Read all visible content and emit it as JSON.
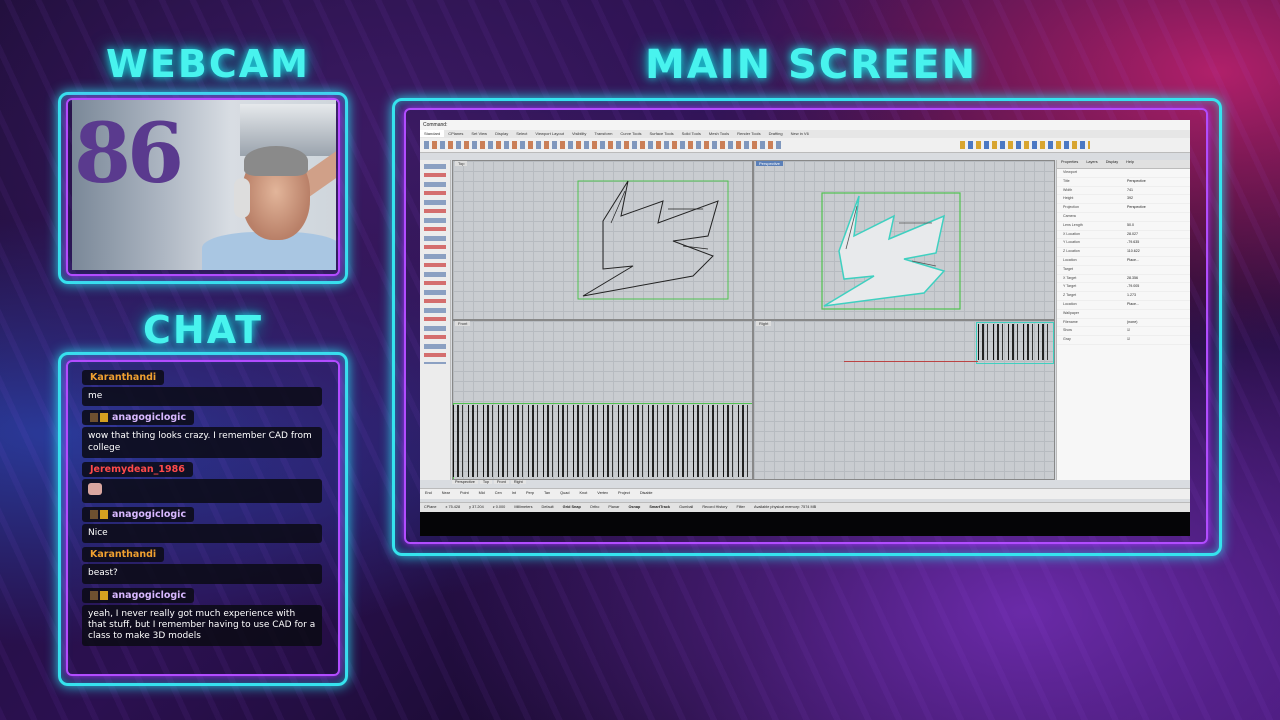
{
  "headings": {
    "webcam": "WEBCAM",
    "main_screen": "MAIN SCREEN",
    "chat": "CHAT"
  },
  "colors": {
    "heading": "#48f3ee",
    "frame": "#35e4ee",
    "frame_accent": "#b24cff"
  },
  "webcam": {
    "overlay_number": "86"
  },
  "chat": {
    "messages": [
      {
        "user": "Karanthandi",
        "color": "#f0a030",
        "text": "me",
        "badges": false
      },
      {
        "user": "anagogiclogic",
        "color": "#d8b8ff",
        "text": "wow that thing looks crazy. I remember CAD from college",
        "badges": true
      },
      {
        "user": "Jeremydean_1986",
        "color": "#ff4a4a",
        "text": "",
        "emote": "emote-icon",
        "badges": false
      },
      {
        "user": "anagogiclogic",
        "color": "#d8b8ff",
        "text": "Nice",
        "badges": true
      },
      {
        "user": "Karanthandi",
        "color": "#f0a030",
        "text": "beast?",
        "badges": false
      },
      {
        "user": "anagogiclogic",
        "color": "#d8b8ff",
        "text": "yeah, I never really got much experience with that stuff, but I remember having to use CAD for a class to make 3D models",
        "badges": true
      }
    ]
  },
  "app": {
    "command_prompt": "Command:",
    "tabs": [
      "Standard",
      "CPlanes",
      "Set View",
      "Display",
      "Select",
      "Viewport Layout",
      "Visibility",
      "Transform",
      "Curve Tools",
      "Surface Tools",
      "Solid Tools",
      "Mesh Tools",
      "Render Tools",
      "Drafting",
      "New in V6"
    ],
    "viewports": {
      "top": "Top",
      "perspective": "Perspective",
      "front": "Front",
      "right": "Right"
    },
    "view_tabs": [
      "Perspective",
      "Top",
      "Front",
      "Right"
    ],
    "properties": {
      "tabs": [
        "Properties",
        "Layers",
        "Display",
        "Help"
      ],
      "rows": [
        {
          "k": "Viewport",
          "v": ""
        },
        {
          "k": "Title",
          "v": "Perspective"
        },
        {
          "k": "Width",
          "v": "741"
        },
        {
          "k": "Height",
          "v": "392"
        },
        {
          "k": "Projection",
          "v": "Perspective"
        },
        {
          "k": "Camera",
          "v": ""
        },
        {
          "k": "Lens Length",
          "v": "50.0"
        },
        {
          "k": "X Location",
          "v": "28.027"
        },
        {
          "k": "Y Location",
          "v": "-79.635"
        },
        {
          "k": "Z Location",
          "v": "110.622"
        },
        {
          "k": "Location",
          "v": "Place..."
        },
        {
          "k": "Target",
          "v": ""
        },
        {
          "k": "X Target",
          "v": "28.356"
        },
        {
          "k": "Y Target",
          "v": "-79.005"
        },
        {
          "k": "Z Target",
          "v": "1.273"
        },
        {
          "k": "Location",
          "v": "Place..."
        },
        {
          "k": "Wallpaper",
          "v": ""
        },
        {
          "k": "Filename",
          "v": "(none)"
        },
        {
          "k": "Show",
          "v": "☑"
        },
        {
          "k": "Gray",
          "v": "☑"
        }
      ]
    },
    "osnap": [
      "End",
      "Near",
      "Point",
      "Mid",
      "Cen",
      "Int",
      "Perp",
      "Tan",
      "Quad",
      "Knot",
      "Vertex",
      "Project",
      "Disable"
    ],
    "status": {
      "cplane": "CPlane",
      "x": "x 75.428",
      "y": "y 37.204",
      "z": "z 0.000",
      "units": "Millimeters",
      "layer": "Default",
      "grid_snap": "Grid Snap",
      "ortho": "Ortho",
      "planar": "Planar",
      "osnap": "Osnap",
      "smarttrack": "SmartTrack",
      "gumball": "Gumball",
      "record_history": "Record History",
      "filter": "Filter",
      "memory": "Available physical memory: 7574 MB"
    }
  }
}
